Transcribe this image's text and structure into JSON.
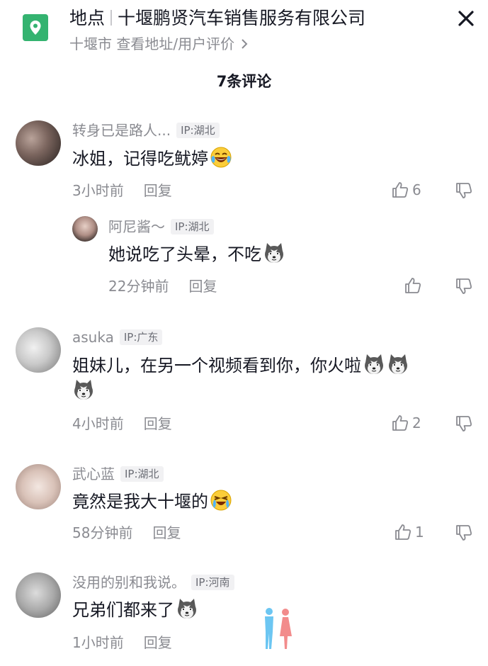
{
  "header": {
    "place_label": "地点",
    "place_name": "十堰鹏贤汽车销售服务有限公司",
    "sub": "十堰市  查看地址/用户评价",
    "comments_count": "7条评论"
  },
  "comments": [
    {
      "user": "转身已是路人...",
      "ip": "IP:湖北",
      "text": "冰姐，记得吃鱿婷",
      "time": "3小时前",
      "reply": "回复",
      "likes": "6",
      "emoji": "laugh-cry-emoji",
      "replies": [
        {
          "user": "阿尼酱～",
          "ip": "IP:湖北",
          "text": "她说吃了头晕，不吃",
          "time": "22分钟前",
          "reply": "回复",
          "emoji": "husky-emoji"
        }
      ]
    },
    {
      "user": "asuka",
      "ip": "IP:广东",
      "text": "姐妹儿，在另一个视频看到你，你火啦",
      "time": "4小时前",
      "reply": "回复",
      "likes": "2",
      "emoji": "husky-emoji"
    },
    {
      "user": "武心蓝",
      "ip": "IP:湖北",
      "text": "竟然是我大十堰的",
      "time": "58分钟前",
      "reply": "回复",
      "likes": "1",
      "emoji": "tears-of-joy-emoji"
    },
    {
      "user": "没用的别和我说。",
      "ip": "IP:河南",
      "text": "兄弟们都来了",
      "time": "1小时前",
      "reply": "回复",
      "emoji": "husky-emoji"
    }
  ],
  "colors": {
    "accent_green": "#34b370",
    "text_primary": "#161823",
    "text_secondary": "#8a8b91"
  }
}
